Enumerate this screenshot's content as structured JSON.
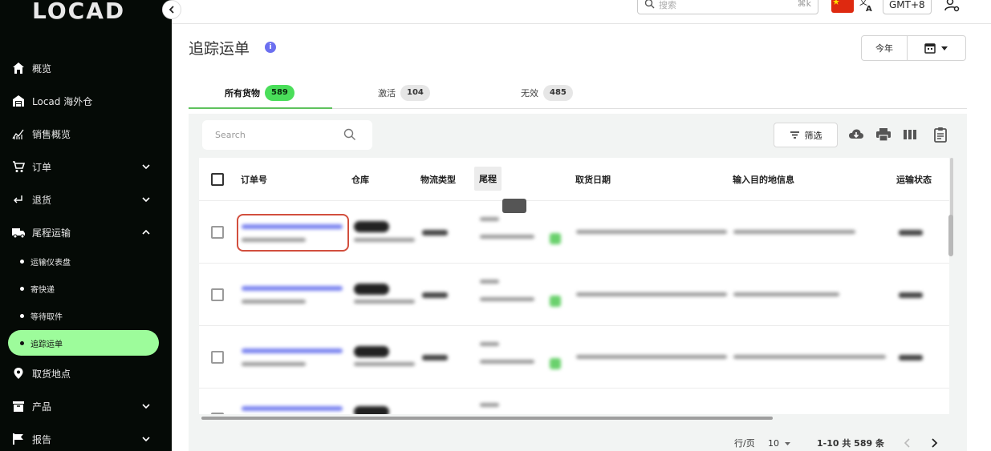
{
  "sidebar": {
    "logo": "LOCAD",
    "items": [
      {
        "label": "概览",
        "icon": "home-icon"
      },
      {
        "label": "Locad 海外仓",
        "icon": "warehouse-icon"
      },
      {
        "label": "销售概览",
        "icon": "analytics-icon"
      },
      {
        "label": "订单",
        "icon": "cart-icon"
      },
      {
        "label": "退货",
        "icon": "return-icon"
      },
      {
        "label": "尾程运输",
        "icon": "truck-icon"
      },
      {
        "label": "取货地点",
        "icon": "location-icon"
      },
      {
        "label": "产品",
        "icon": "box-icon"
      },
      {
        "label": "报告",
        "icon": "flag-icon"
      }
    ],
    "sub_items": [
      {
        "label": "运输仪表盘"
      },
      {
        "label": "寄快递"
      },
      {
        "label": "等待取件"
      },
      {
        "label": "追踪运单",
        "active": true
      }
    ],
    "accent": "#9dfc9b"
  },
  "topbar": {
    "search_placeholder": "搜索",
    "search_shortcut": "⌘k",
    "timezone": "GMT+8"
  },
  "page": {
    "title": "追踪运单",
    "range_label": "今年"
  },
  "tabs": [
    {
      "label": "所有货物",
      "count": "589",
      "active": true
    },
    {
      "label": "激活",
      "count": "104"
    },
    {
      "label": "无效",
      "count": "485"
    }
  ],
  "table": {
    "search_placeholder": "Search",
    "filter_label": "筛选",
    "columns": [
      "订单号",
      "仓库",
      "物流类型",
      "尾程",
      "取货日期",
      "输入目的地信息",
      "运输状态"
    ],
    "sorted_column": "尾程"
  },
  "pagination": {
    "rows_per_page_label": "行/页",
    "rows_per_page": "10",
    "range": "1-10 共 589 条"
  }
}
